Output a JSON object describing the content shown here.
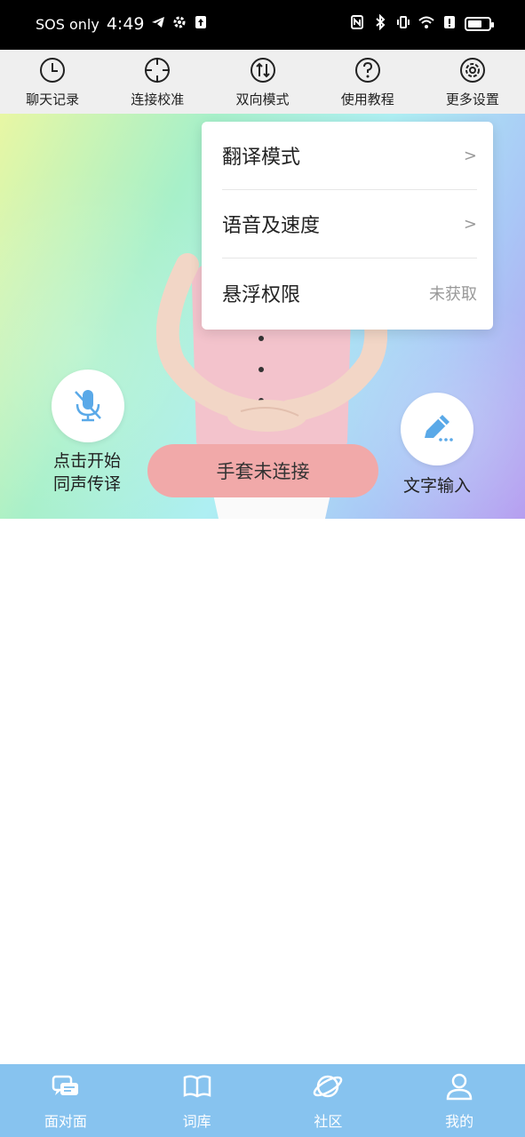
{
  "status_bar": {
    "carrier": "SOS only",
    "time": "4:49",
    "battery_percent": 70
  },
  "toolbar": {
    "items": [
      {
        "label": "聊天记录",
        "icon": "clock-icon"
      },
      {
        "label": "连接校准",
        "icon": "crosshair-icon"
      },
      {
        "label": "双向模式",
        "icon": "swap-icon"
      },
      {
        "label": "使用教程",
        "icon": "help-icon"
      },
      {
        "label": "更多设置",
        "icon": "gear-icon"
      }
    ]
  },
  "dropdown": {
    "items": [
      {
        "label": "翻译模式",
        "trail": ">"
      },
      {
        "label": "语音及速度",
        "trail": ">"
      },
      {
        "label": "悬浮权限",
        "trail": "未获取"
      }
    ]
  },
  "avatar_area": {
    "mic_label_line1": "点击开始",
    "mic_label_line2": "同声传译",
    "glove_status": "手套未连接",
    "text_input_label": "文字输入"
  },
  "bottom_nav": {
    "items": [
      {
        "label": "面对面",
        "icon": "chat-icon"
      },
      {
        "label": "词库",
        "icon": "book-icon"
      },
      {
        "label": "社区",
        "icon": "planet-icon"
      },
      {
        "label": "我的",
        "icon": "user-icon"
      }
    ]
  },
  "colors": {
    "nav_bg": "#87c3ef",
    "glove_button": "#f1a9a9",
    "icon_blue": "#5aa9e8"
  }
}
